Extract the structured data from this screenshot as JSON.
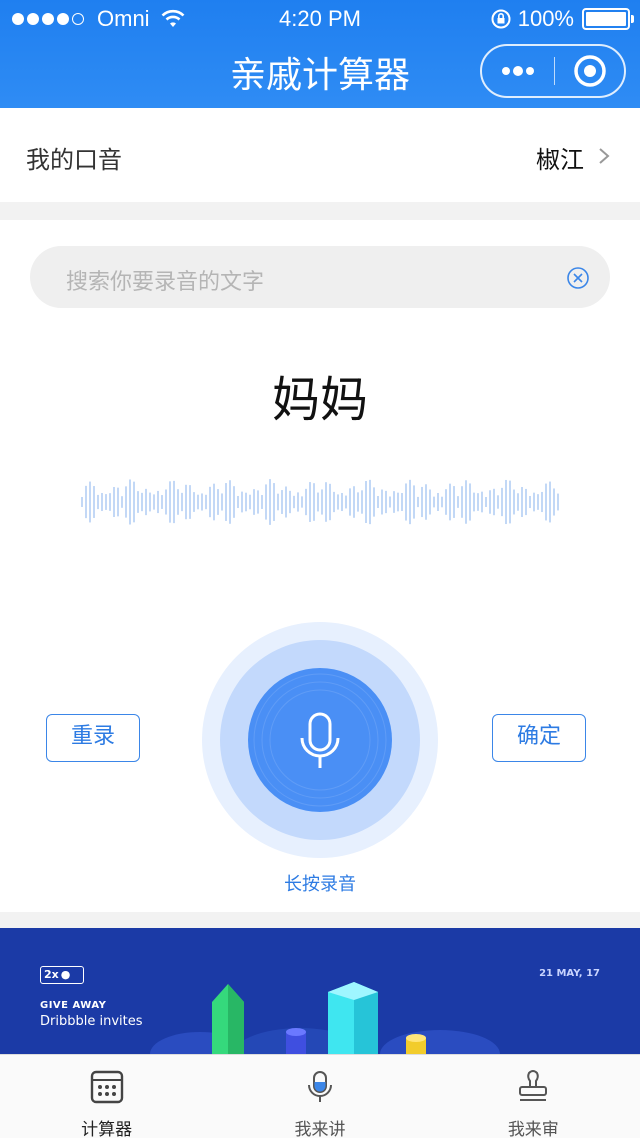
{
  "status_bar": {
    "carrier": "Omni",
    "time": "4:20 PM",
    "battery": "100%"
  },
  "nav": {
    "title": "亲戚计算器"
  },
  "accent": {
    "label": "我的口音",
    "value": "椒江"
  },
  "search": {
    "placeholder": "搜索你要录音的文字"
  },
  "current_word": "妈妈",
  "buttons": {
    "retake": "重录",
    "confirm": "确定",
    "record_hint": "长按录音"
  },
  "banner": {
    "badge": "2x",
    "line1": "GIVE AWAY",
    "line2": "Dribbble invites",
    "date": "21 MAY, 17"
  },
  "tabs": [
    {
      "label": "计算器"
    },
    {
      "label": "我来讲"
    },
    {
      "label": "我来审"
    }
  ],
  "colors": {
    "primary": "#2f8cf4",
    "accent_text": "#2d7be3",
    "record_core": "#4a8ff5",
    "banner_bg": "#1b3aa6"
  }
}
